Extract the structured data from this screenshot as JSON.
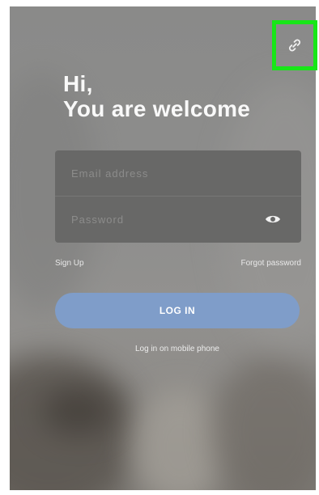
{
  "greeting": {
    "line1": "Hi,",
    "line2": "You are welcome"
  },
  "form": {
    "email_placeholder": "Email address",
    "password_placeholder": "Password"
  },
  "links": {
    "sign_up": "Sign Up",
    "forgot_password": "Forgot password"
  },
  "login_button": "LOG IN",
  "phone_login": "Log in on mobile phone",
  "icons": {
    "settings": "link-icon",
    "password_visibility": "eye-icon"
  },
  "colors": {
    "accent": "#7f9dc9",
    "highlight": "#18e618",
    "card": "#686867"
  }
}
